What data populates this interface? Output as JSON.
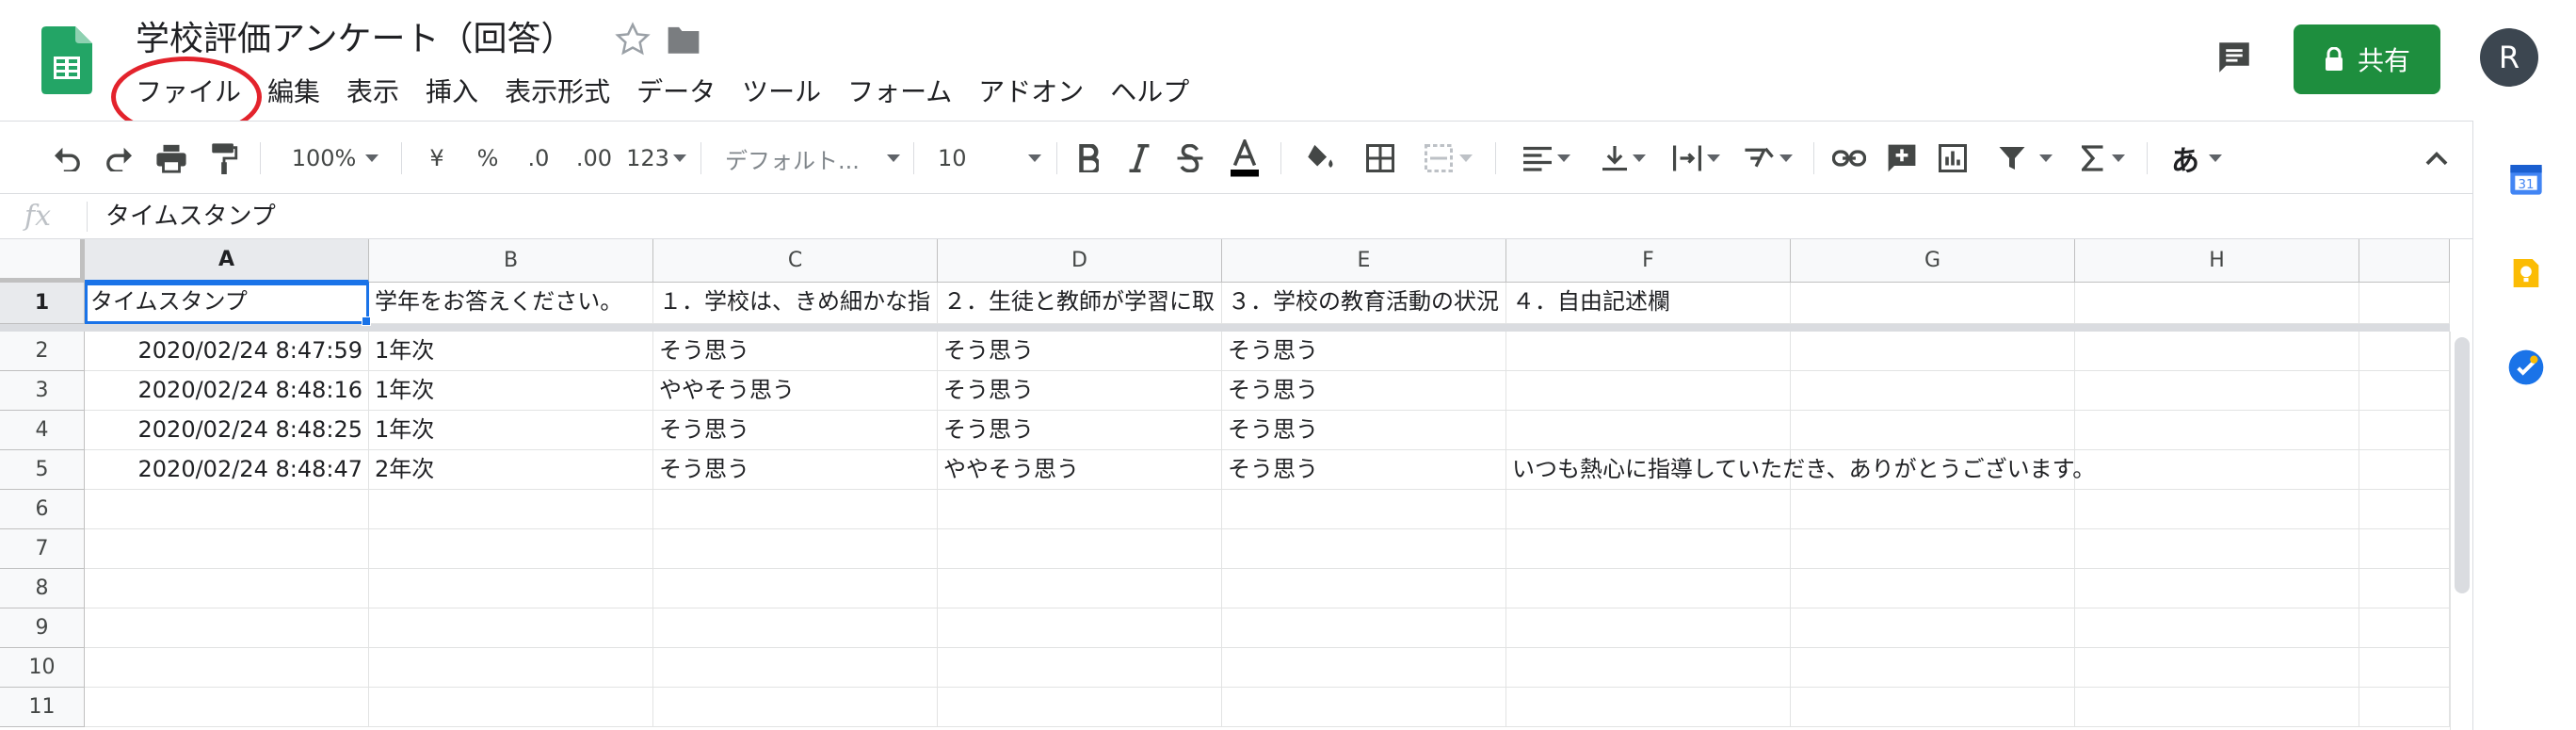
{
  "document": {
    "title": "学校評価アンケート（回答）"
  },
  "menu": [
    "ファイル",
    "編集",
    "表示",
    "挿入",
    "表示形式",
    "データ",
    "ツール",
    "フォーム",
    "アドオン",
    "ヘルプ"
  ],
  "header": {
    "share_label": "共有",
    "avatar_initial": "R",
    "accent_color": "#1e8e3e"
  },
  "toolbar": {
    "zoom": "100%",
    "currency": "¥",
    "percent": "%",
    "decrease_decimal": ".0",
    "increase_decimal": ".00",
    "more_formats": "123",
    "font": "デフォルト...",
    "font_size": "10",
    "input_tools": "あ"
  },
  "formula_bar": {
    "fx_label": "fx",
    "value": "タイムスタンプ"
  },
  "sheet": {
    "columns": [
      "A",
      "B",
      "C",
      "D",
      "E",
      "F",
      "G",
      "H"
    ],
    "row_numbers": [
      "1",
      "2",
      "3",
      "4",
      "5",
      "6",
      "7",
      "8",
      "9",
      "10",
      "11"
    ],
    "header_row": [
      "タイムスタンプ",
      "学年をお答えください。",
      "１．学校は、きめ細かな指",
      "２．生徒と教師が学習に取",
      "３．学校の教育活動の状況",
      "４．自由記述欄",
      "",
      ""
    ],
    "rows": [
      [
        "2020/02/24 8:47:59",
        "1年次",
        "そう思う",
        "そう思う",
        "そう思う",
        "",
        "",
        ""
      ],
      [
        "2020/02/24 8:48:16",
        "1年次",
        "ややそう思う",
        "そう思う",
        "そう思う",
        "",
        "",
        ""
      ],
      [
        "2020/02/24 8:48:25",
        "1年次",
        "そう思う",
        "そう思う",
        "そう思う",
        "",
        "",
        ""
      ],
      [
        "2020/02/24 8:48:47",
        "2年次",
        "そう思う",
        "ややそう思う",
        "そう思う",
        "いつも熱心に指導していただき、ありがとうございます。",
        "",
        ""
      ]
    ]
  }
}
